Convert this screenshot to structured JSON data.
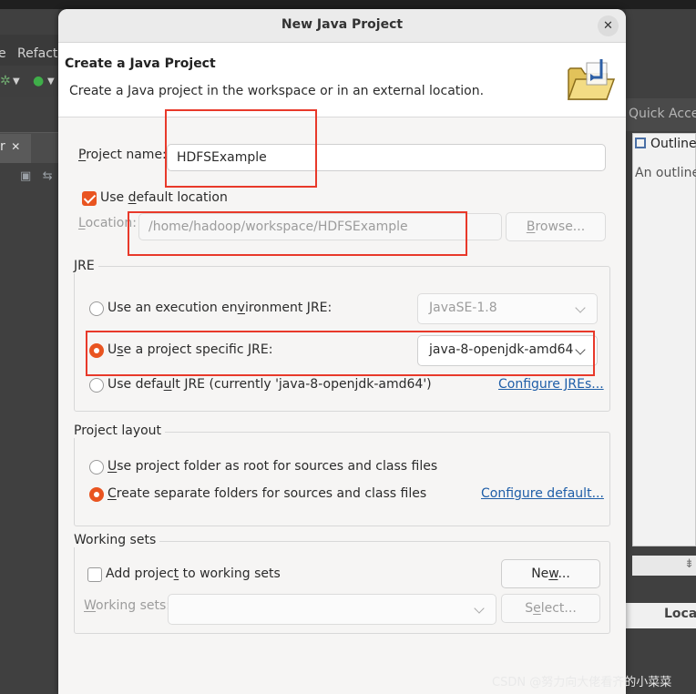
{
  "background": {
    "menu_item_left": "e",
    "menu_item": "Refact",
    "explorer_tab_suffix": "r",
    "explorer_tab_close": "✕",
    "quick_access": "Quick Access",
    "outline_tab": "Outline",
    "outline_text": "An outline",
    "bottom_tab": "Locat",
    "watermark": "CSDN @努力向大佬看齐的小菜菜"
  },
  "dialog": {
    "title": "New Java Project",
    "close_icon": "close-icon",
    "header_title": "Create a Java Project",
    "header_description": "Create a Java project in the workspace or in an external location.",
    "header_icon": "folder-icon",
    "project_name_label_pre": "P",
    "project_name_label_post": "roject name:",
    "project_name_value": "HDFSExample",
    "use_default_location_pre": "Use ",
    "use_default_location_key": "d",
    "use_default_location_post": "efault location",
    "use_default_location_checked": true,
    "location_label_pre": "L",
    "location_label_post": "ocation:",
    "location_value": "/home/hadoop/workspace/HDFSExample",
    "browse_button_pre": "B",
    "browse_button_post": "rowse...",
    "jre_group": {
      "title": "JRE",
      "option_env_pre": "Use an execution en",
      "option_env_key": "v",
      "option_env_post": "ironment JRE:",
      "option_env_value": "JavaSE-1.8",
      "option_specific_pre": "U",
      "option_specific_key": "s",
      "option_specific_post": "e a project specific JRE:",
      "option_specific_value": "java-8-openjdk-amd64",
      "option_default_pre": "Use defa",
      "option_default_key": "u",
      "option_default_post": "lt JRE (currently 'java-8-openjdk-amd64')",
      "configure_jres_link": "Configure JREs...",
      "selected": "specific"
    },
    "layout_group": {
      "title": "Project layout",
      "option_root_pre": "",
      "option_root_key": "U",
      "option_root_post": "se project folder as root for sources and class files",
      "option_separate_pre": "",
      "option_separate_key": "C",
      "option_separate_post": "reate separate folders for sources and class files",
      "configure_default_link": "Configure default...",
      "selected": "separate"
    },
    "working_sets_group": {
      "title": "Working sets",
      "add_to_sets_pre": "Add projec",
      "add_to_sets_key": "t",
      "add_to_sets_post": " to working sets",
      "add_to_sets_checked": false,
      "new_button_pre": "Ne",
      "new_button_key": "w",
      "new_button_post": "...",
      "working_sets_label_pre": "W",
      "working_sets_label_key": "o",
      "working_sets_label_post": "rking sets:",
      "working_sets_value": "",
      "select_button_pre": "S",
      "select_button_key": "e",
      "select_button_post": "lect..."
    }
  },
  "colors": {
    "accent": "#e95420",
    "highlight_box": "#e8392a",
    "link": "#1f5ea8"
  }
}
